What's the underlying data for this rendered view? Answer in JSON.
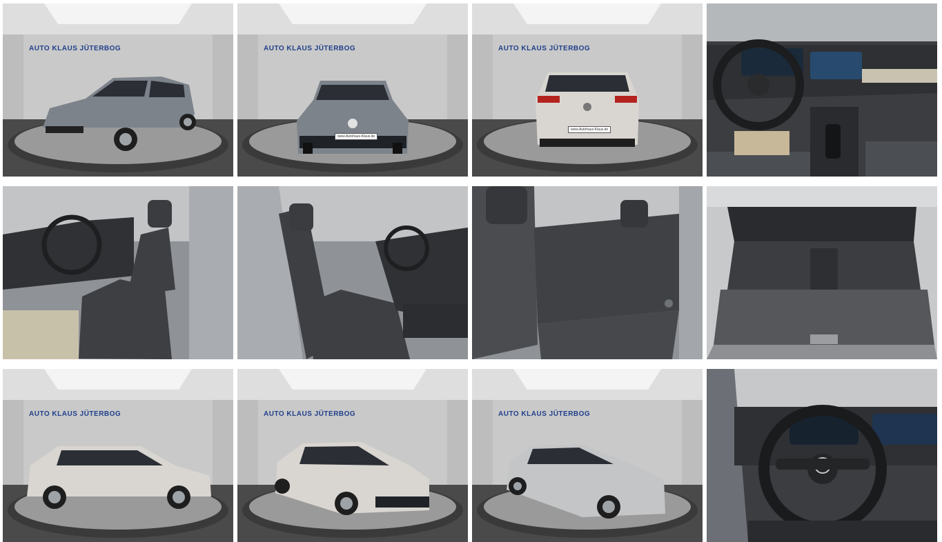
{
  "gallery": {
    "showroom_sign": "AUTO KLAUS JÜTERBOG",
    "plate_text": "www.Autohaus-Klaus.de",
    "colors": {
      "wall": "#c9c9c9",
      "ceiling": "#dedede",
      "floor_dark": "#4a4a4a",
      "turntable": "#9a9a9a",
      "car_grey": "#7d838b",
      "car_white": "#d9d6d1",
      "interior_dark": "#3b3d40",
      "brand_blue": "#1f3f8a",
      "brand_red": "#c8202b"
    },
    "photos": [
      {
        "id": "exterior-front-left-grey",
        "kind": "exterior"
      },
      {
        "id": "exterior-front-grey",
        "kind": "exterior"
      },
      {
        "id": "exterior-rear-white",
        "kind": "exterior"
      },
      {
        "id": "interior-dashboard",
        "kind": "interior"
      },
      {
        "id": "interior-front-seats-left",
        "kind": "interior"
      },
      {
        "id": "interior-front-seats-right",
        "kind": "interior"
      },
      {
        "id": "interior-rear-seats",
        "kind": "interior"
      },
      {
        "id": "trunk",
        "kind": "interior"
      },
      {
        "id": "exterior-side-right",
        "kind": "exterior"
      },
      {
        "id": "exterior-front-right-angle",
        "kind": "exterior"
      },
      {
        "id": "exterior-front-right-side",
        "kind": "exterior"
      },
      {
        "id": "interior-steering-wheel",
        "kind": "interior"
      }
    ]
  }
}
